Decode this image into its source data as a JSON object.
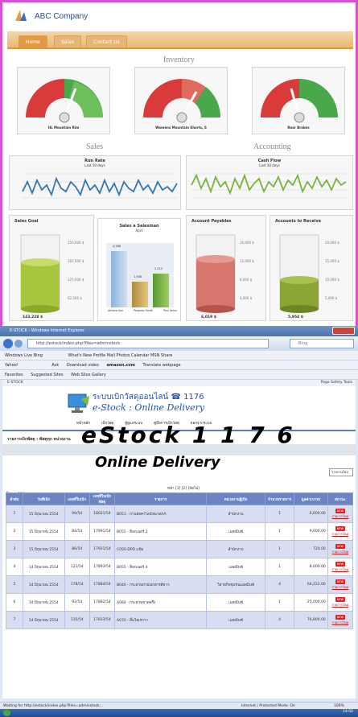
{
  "dashboard": {
    "company": "ABC Company",
    "tabs": [
      "Home",
      "Sales",
      "Contact Us"
    ],
    "sections": {
      "inventory": "Inventory",
      "sales": "Sales",
      "accounting": "Accounting"
    },
    "gauges": [
      {
        "label": "HL Mountain Rim",
        "min": "0",
        "max": "1.8K",
        "mid_left": "450",
        "mid_right": "1.35K",
        "top": "900"
      },
      {
        "label": "Womens Mountain Shorts, S",
        "min": "0",
        "max": "1.4K",
        "mid_left": "350",
        "mid_right": "1.05K",
        "top": "700"
      },
      {
        "label": "Rear Brakes",
        "min": "0",
        "max": "1.8K",
        "mid_left": "450",
        "mid_right": "1.35K",
        "top": "900"
      }
    ],
    "run_rate": {
      "title": "Run Rate",
      "subtitle": "Last 30 days"
    },
    "cash_flow": {
      "title": "Cash Flow",
      "subtitle": "Last 30 days"
    },
    "sales_goal": {
      "title": "Sales Goal",
      "value": "143,228 $",
      "ticks": [
        "250,000 $",
        "187,500 $",
        "125,000 $",
        "62,500 $",
        "0 $"
      ]
    },
    "sales_salesman": {
      "title": "Sales a Salesman",
      "subtitle": "April",
      "bars": [
        {
          "name": "Jakiana Ave",
          "value": "4,268",
          "fraction": 1.0
        },
        {
          "name": "Pergado Smith",
          "value": "1,908",
          "fraction": 0.45
        },
        {
          "name": "Paul Jonas",
          "value": "2,512",
          "fraction": 0.59
        }
      ]
    },
    "payables": {
      "title": "Account Payables",
      "value": "6,019 $",
      "ticks": [
        "16,000 $",
        "12,000 $",
        "8,000 $",
        "4,000 $",
        "0 $"
      ]
    },
    "receivable": {
      "title": "Accounts to Receive",
      "value": "5,954 $",
      "ticks": [
        "20,000 $",
        "15,000 $",
        "10,000 $",
        "5,000 $",
        "0 $"
      ]
    },
    "colors": {
      "accent": "#e39a47",
      "gauge_red": "#d93b3b",
      "gauge_green": "#49a84a",
      "bar_blue": "#9cc0e6"
    }
  },
  "browser": {
    "window_title": "E-STOCK - Windows Internet Explorer",
    "url": "http://estock/index.php?files=adminstock",
    "search_placeholder": "Bing",
    "toolbar1": [
      "Windows Live  Bing",
      "What's New  Profile  Mail  Photos  Calendar  MSN  Share"
    ],
    "toolbar2": [
      "Yahoo!",
      "Ask",
      "Download video",
      "amazon.com",
      "Translate webpage"
    ],
    "favorites": [
      "Favorites",
      "Suggested Sites",
      "Web Slice Gallery"
    ],
    "tab_label": "E-STOCK",
    "tab_tools": "Page  Safety  Tools",
    "status": "Waiting for http://estock/index.php?files=adminstock...",
    "zone": "Internet | Protected Mode: On",
    "zoom": "100%",
    "clock": "14:02"
  },
  "estock": {
    "title": "eStock  1 1 7 6",
    "subtitle": "Online Delivery",
    "thai_heading": "ระบบเบิกวัสดุออนไลน์ ☎ 1176",
    "heading_en": "e-Stock : Online Delivery",
    "menu": [
      "หน้าหลัก",
      "เบิกวัสดุ",
      "ผู้ดูแลระบบ",
      "คู่มือการเบิกวัสดุ",
      "ออกจากระบบ"
    ],
    "breadcrumb": "รายการเบิกพัสดุ : พัสดุทุก หน่วยงาน",
    "count_label": "ทั้งหมด 280 รายการ",
    "select_value": "รายงานใหม่",
    "pager": "หน้า [1] [2] [ถัดไป]",
    "columns": [
      "ลำดับ",
      "วันที่เบิก",
      "เลขที่ใบเบิก",
      "เลขที่ใบเบิกพัสดุ",
      "รายการ",
      "หน่วยงานผู้เบิก",
      "จำนวนรายการ",
      "มูลค่า(บาท)",
      "สถานะ"
    ],
    "rows": [
      [
        "1",
        "15 มิถุนายน 2554",
        "99/54",
        "18021/54",
        "B051 - ถ่านอัลคาไลน์ขนาดAA",
        "สำนักงาน",
        "1",
        "6,600.00",
        "รายการใหม่"
      ],
      [
        "2",
        "15 มิถุนายน 2554",
        "84/54",
        "17991/54",
        "B055 - ท็อกเนอร์ 2",
        "แอดมินซ์",
        "1",
        "9,600.00",
        "รายการใหม่"
      ],
      [
        "3",
        "15 มิถุนายน 2554",
        "86/54",
        "17921/54",
        "C050-DPD แฟ้ม",
        "สำนักงาน",
        "1",
        "720.00",
        "รายการใหม่"
      ],
      [
        "4",
        "14 มิถุนายน 2554",
        "121/54",
        "17893/54",
        "B055 - ท็อกเนอร์ 4",
        "แอดมินซ์",
        "1",
        "8,000.00",
        "รายการใหม่"
      ],
      [
        "5",
        "14 มิถุนายน 2554",
        "178/54",
        "17884/54",
        "B040 - กระดาษถ่ายเอกสารสีขาว",
        "วิสาหกิจชุมชนแอดมินซ์",
        "4",
        "64,222.00",
        "รายการใหม่"
      ],
      [
        "6",
        "14 มิถุนายน 2554",
        "92/54",
        "17882/54",
        "A084 - กระดาษขาดครึ่ง",
        "แอดมินซ์",
        "1",
        "25,000.00",
        "รายการใหม่"
      ],
      [
        "7",
        "14 มิถุนายน 2554",
        "135/54",
        "17833/54",
        "A070 - ลิ้นโอเรกาว",
        "แอดมินซ์",
        "4",
        "76,800.00",
        "รายการใหม่"
      ]
    ],
    "order_badge": "NEW"
  }
}
